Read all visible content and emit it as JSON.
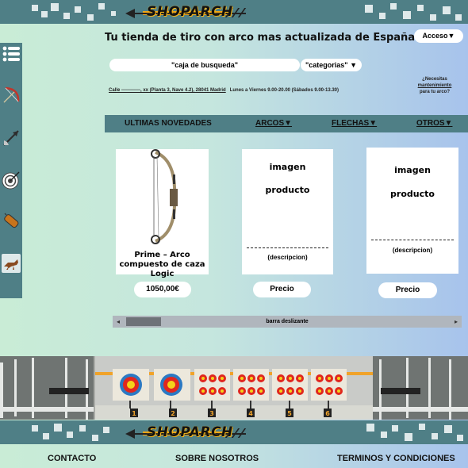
{
  "brand": {
    "logo_text": "SHOPARCH"
  },
  "header": {
    "title": "Tu tienda de tiro con arco mas actualizada de España",
    "access_label": "Acceso▼"
  },
  "sidebar": {
    "items": [
      {
        "icon": "menu-icon"
      },
      {
        "icon": "bow-icon"
      },
      {
        "icon": "arrow-icon"
      },
      {
        "icon": "target-icon"
      },
      {
        "icon": "quiver-icon"
      },
      {
        "icon": "fox-icon"
      }
    ]
  },
  "search": {
    "placeholder": "\"caja de busqueda\"",
    "category_label": "\"categorias\" ▼"
  },
  "info": {
    "address": "Calle ------------, xx (Planta 3, Nave 4.2), 28041 Madrid",
    "hours": "Lunes a Viernes 9.00-20.00 (Sábados 9.00-13.30)",
    "help_line1": "¿Necesitas",
    "help_link": "mantenimiento",
    "help_line3": "para tu arco?"
  },
  "nav": {
    "items": [
      "ULTIMAS NOVEDADES",
      "ARCOS▼",
      "FLECHAS▼",
      "OTROS▼"
    ]
  },
  "products": [
    {
      "name": "Prime – Arco compuesto de caza Logic",
      "price": "1050,00€"
    },
    {
      "image_line1": "imagen",
      "image_line2": "producto",
      "description": "(descripcion)",
      "price": "Precio"
    },
    {
      "image_line1": "imagen",
      "image_line2": "producto",
      "description": "(descripcion)",
      "price": "Precio"
    }
  ],
  "scrollbar": {
    "label": "barra deslizante",
    "left_arrow": "◂",
    "right_arrow": "▸"
  },
  "range": {
    "lane_numbers": [
      "1",
      "2",
      "3",
      "4",
      "5",
      "6"
    ]
  },
  "footer": {
    "links": [
      "CONTACTO",
      "SOBRE NOSOTROS",
      "TERMINOS Y CONDICIONES"
    ]
  },
  "colors": {
    "band": "#4f7f86",
    "accent": "#f2a716"
  }
}
